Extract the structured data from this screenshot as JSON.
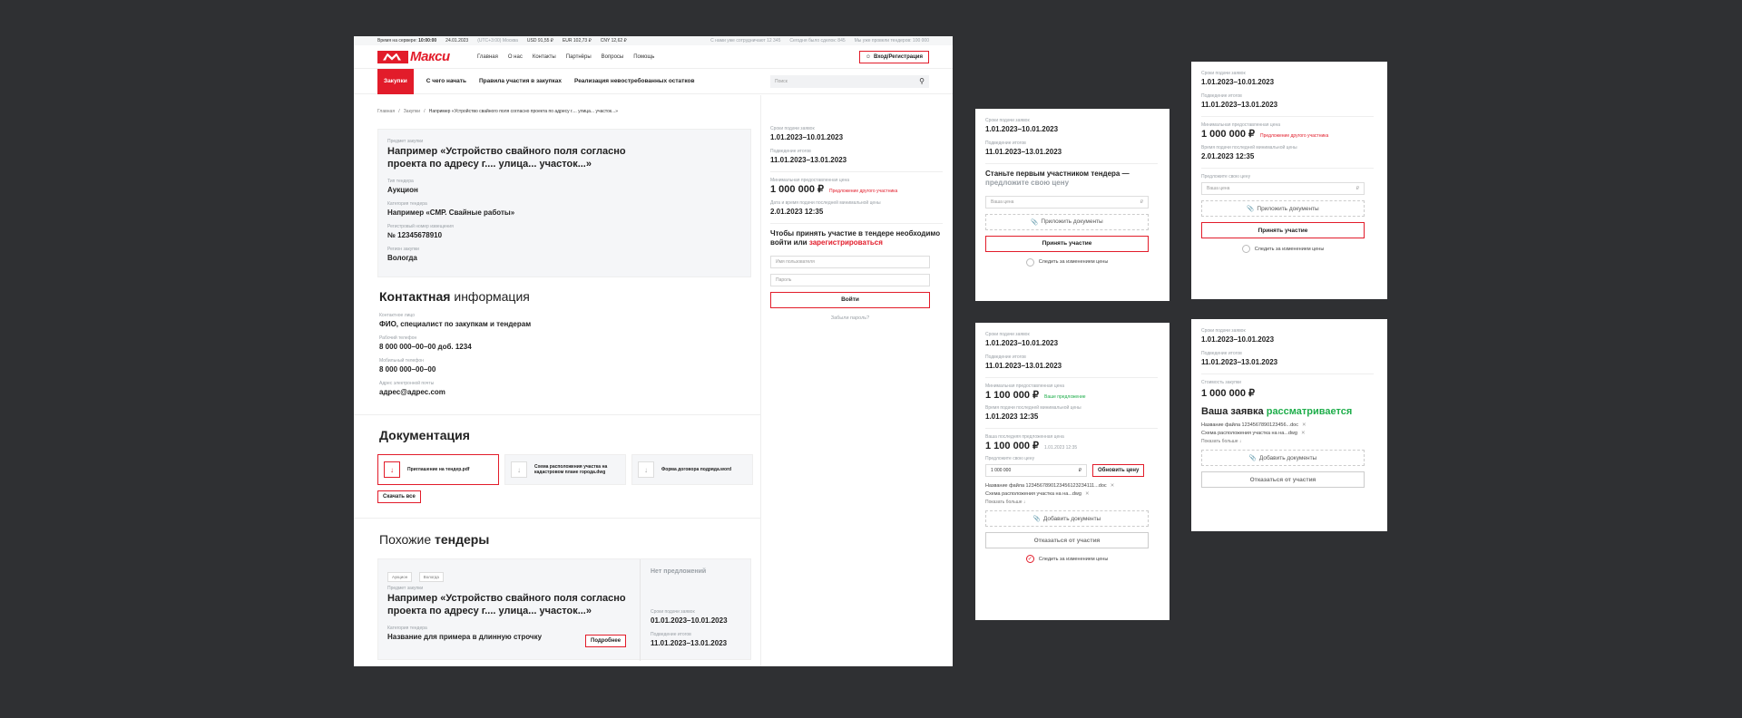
{
  "topbar": {
    "server_time_label": "Время на сервере:",
    "server_time": "10:00:00",
    "server_date": "24.01.2023",
    "timezone": "(UTC+3:00) Москва",
    "usd": "USD 91,55 ₽",
    "eur": "EUR 102,73 ₽",
    "cny": "CNY 12,62 ₽",
    "stat1": "С нами уже сотрудничают 12 345",
    "stat2": "Сегодня было сделок: 845",
    "stat3": "Мы уже провели тендеров: 100 000"
  },
  "header": {
    "logo_text": "Макси",
    "nav": [
      "Главная",
      "О нас",
      "Контакты",
      "Партнёры",
      "Вопросы",
      "Помощь"
    ],
    "login": "Вход/Регистрация"
  },
  "subnav": {
    "items": [
      "Закупки",
      "С чего начать",
      "Правила участия в закупках",
      "Реализация невостребованных остатков"
    ],
    "search_placeholder": "Поиск"
  },
  "breadcrumb": [
    "Главная",
    "Закупки",
    "Например «Устройство свайного поля согласно проекта по адресу г.... улица... участок...»"
  ],
  "tender": {
    "subject_label": "Предмет закупки",
    "subject": "Например «Устройство свайного поля согласно проекта по адресу г.... улица... участок...»",
    "type_label": "Тип тендера",
    "type": "Аукцион",
    "category_label": "Категория тендера",
    "category": "Например «СМР. Свайные работы»",
    "reg_label": "Регистровый номер извещения",
    "reg": "№ 12345678910",
    "region_label": "Регион закупки",
    "region": "Вологда"
  },
  "contacts": {
    "title_bold": "Контактная",
    "title_rest": " информация",
    "person_label": "Контактное лицо",
    "person": "ФИО, специалист по закупкам и тендерам",
    "work_label": "Рабочий телефон",
    "work": "8 000 000–00–00 доб. 1234",
    "mobile_label": "Мобильный телефон",
    "mobile": "8 000 000–00–00",
    "email_label": "Адрес электронной почты",
    "email": "адрес@адрес.com"
  },
  "documents": {
    "title": "Документация",
    "files": [
      "Приглашение на тендер.pdf",
      "Схема расположения участка на кадастровом плане города.dwg",
      "Форма договора подряда.word"
    ],
    "download_all": "Скачать все"
  },
  "similar": {
    "title_light": "Похожие ",
    "title_bold": "тендеры",
    "tags": [
      "Аукцион",
      "Вологда"
    ],
    "subject_label": "Предмет закупки",
    "subject": "Например «Устройство свайного поля согласно проекта по адресу г.... улица... участок...»",
    "category_label": "Категория тендера",
    "category": "Название для примера в длинную строчку",
    "more_btn": "Подробнее",
    "no_offers": "Нет предложений",
    "deadline_label": "Сроки подачи заявок",
    "deadline": "01.01.2023–10.01.2023",
    "results_label": "Подведение итогов",
    "results": "11.01.2023–13.01.2023"
  },
  "side": {
    "deadline_label": "Сроки подачи заявок",
    "deadline": "1.01.2023–10.01.2023",
    "results_label": "Подведение итогов",
    "results": "11.01.2023–13.01.2023",
    "min_label": "Минимальная предоставленная цена",
    "min_price": "1 000 000 ₽",
    "other_offer": "Предложение другого участника",
    "last_label": "Дата и время подачи последней минимальной цены",
    "last": "2.01.2023 12:35",
    "login_title": "Чтобы принять участие в тендере необходимо войти или ",
    "login_link": "зарегистрироваться",
    "username_ph": "Имя пользователя",
    "password_ph": "Пароль",
    "login_btn": "Войти",
    "forgot": "Забыли пароль?"
  },
  "panel1": {
    "deadline_label": "Сроки подачи заявок",
    "deadline": "1.01.2023–10.01.2023",
    "results_label": "Подведение итогов",
    "results": "11.01.2023–13.01.2023",
    "cta_bold": "Станьте первым участником тендера —",
    "cta_light": "предложите свою цену",
    "price_ph": "Ваша цена",
    "attach": "Приложить документы",
    "participate": "Принять участие",
    "watch": "Следить за изменением цены"
  },
  "panel2": {
    "deadline_label": "Сроки подачи заявок",
    "deadline": "1.01.2023–10.01.2023",
    "results_label": "Подведение итогов",
    "results": "11.01.2023–13.01.2023",
    "min_label": "Минимальная предоставленная цена",
    "min_price": "1 000 000 ₽",
    "other_offer": "Предложение другого участника",
    "last_label": "Время подачи последней минимальной цены",
    "last": "2.01.2023 12:35",
    "offer_label": "Предложите свою цену",
    "price_ph": "Ваша цена",
    "attach": "Приложить документы",
    "participate": "Принять участие",
    "watch": "Следить за изменением цены"
  },
  "panel3": {
    "deadline_label": "Сроки подачи заявок",
    "deadline": "1.01.2023–10.01.2023",
    "results_label": "Подведение итогов",
    "results": "11.01.2023–13.01.2023",
    "min_label": "Минимальная предоставленная цена",
    "min_price": "1 100 000 ₽",
    "your_offer": "Ваше предложение",
    "last_label": "Время подачи последней минимальной цены",
    "last": "1.01.2023 12:35",
    "my_label": "Ваша последняя предложенная цена",
    "my_price": "1 100 000 ₽",
    "my_date": "1.01.2023 12:35",
    "offer_label": "Предложите свою цену",
    "offer_value": "1 000 000",
    "update_btn": "Обновить цену",
    "file1": "Название файла 1234567890123456123234111...doc",
    "file2": "Схема расположения участка на на...dwg",
    "show_more": "Показать больше ↓",
    "add_docs": "Добавить документы",
    "decline": "Отказаться от участия",
    "watch": "Следить за изменением цены"
  },
  "panel4": {
    "deadline_label": "Сроки подачи заявок",
    "deadline": "1.01.2023–10.01.2023",
    "results_label": "Подведение итогов",
    "results": "11.01.2023–13.01.2023",
    "cost_label": "Стоимость закупки",
    "cost": "1 000 000 ₽",
    "status_bold": "Ваша заявка ",
    "status_green": "рассматривается",
    "file1": "Название файла 1234567890123456...doc",
    "file2": "Схема расположения участка на на...dwg",
    "show_more": "Показать больше ↓",
    "add_docs": "Добавить документы",
    "decline": "Отказаться от участия"
  },
  "colors": {
    "accent": "#e21c2a",
    "green": "#1fae4b",
    "backdrop": "#2f3033"
  }
}
